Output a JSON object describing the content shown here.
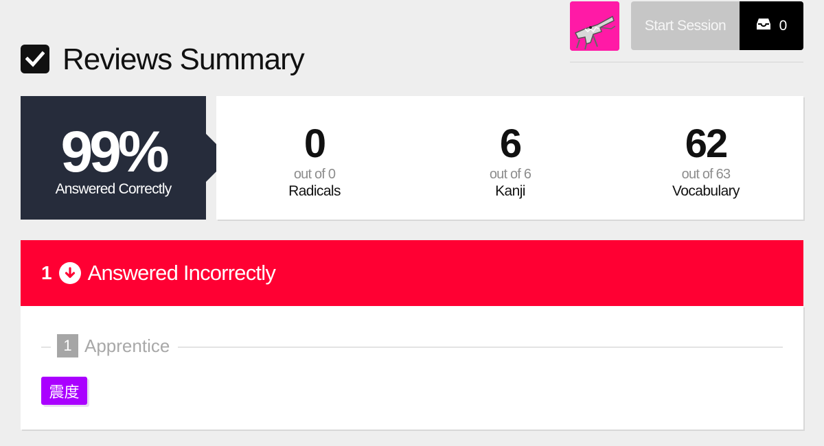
{
  "header": {
    "title": "Reviews Summary",
    "start_session_label": "Start Session",
    "inbox_count": "0"
  },
  "summary": {
    "percent": "99%",
    "percent_label": "Answered Correctly",
    "stats": [
      {
        "count": "0",
        "out_of": "out of 0",
        "label": "Radicals"
      },
      {
        "count": "6",
        "out_of": "out of 6",
        "label": "Kanji"
      },
      {
        "count": "62",
        "out_of": "out of 63",
        "label": "Vocabulary"
      }
    ]
  },
  "incorrect": {
    "count": "1",
    "label": "Answered Incorrectly",
    "groups": [
      {
        "count": "1",
        "label": "Apprentice",
        "items": [
          "震度"
        ]
      }
    ]
  },
  "colors": {
    "incorrect_header": "#ff0033",
    "vocab_chip": "#aa00ff",
    "summary_dark": "#262c3b",
    "avatar_bg": "#ff1aa6"
  },
  "icons": {
    "title": "checkbox-icon",
    "inbox": "inbox-icon",
    "incorrect": "arrow-down-circle-icon",
    "avatar": "crocodile-avatar"
  }
}
